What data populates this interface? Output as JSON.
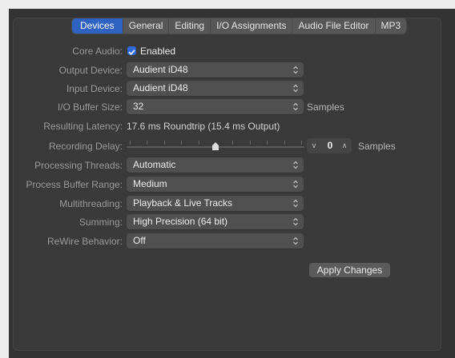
{
  "tabs": [
    "Devices",
    "General",
    "Editing",
    "I/O Assignments",
    "Audio File Editor",
    "MP3"
  ],
  "active_tab": "Devices",
  "core_audio": {
    "label": "Core Audio:",
    "checkbox_label": "Enabled",
    "checked": true
  },
  "output_device": {
    "label": "Output Device:",
    "value": "Audient iD48"
  },
  "input_device": {
    "label": "Input Device:",
    "value": "Audient iD48"
  },
  "io_buffer": {
    "label": "I/O Buffer Size:",
    "value": "32",
    "unit": "Samples"
  },
  "latency": {
    "label": "Resulting Latency:",
    "value": "17.6 ms Roundtrip (15.4 ms Output)"
  },
  "recording_delay": {
    "label": "Recording Delay:",
    "value": "0",
    "unit": "Samples",
    "slider_position": 0.5
  },
  "processing_threads": {
    "label": "Processing Threads:",
    "value": "Automatic"
  },
  "process_buffer": {
    "label": "Process Buffer Range:",
    "value": "Medium"
  },
  "multithreading": {
    "label": "Multithreading:",
    "value": "Playback & Live Tracks"
  },
  "summing": {
    "label": "Summing:",
    "value": "High Precision (64 bit)"
  },
  "rewire": {
    "label": "ReWire Behavior:",
    "value": "Off"
  },
  "apply_button": "Apply Changes",
  "colors": {
    "accent": "#2f63c2",
    "window_bg": "#333333",
    "panel_bg": "#3a3a3a"
  }
}
